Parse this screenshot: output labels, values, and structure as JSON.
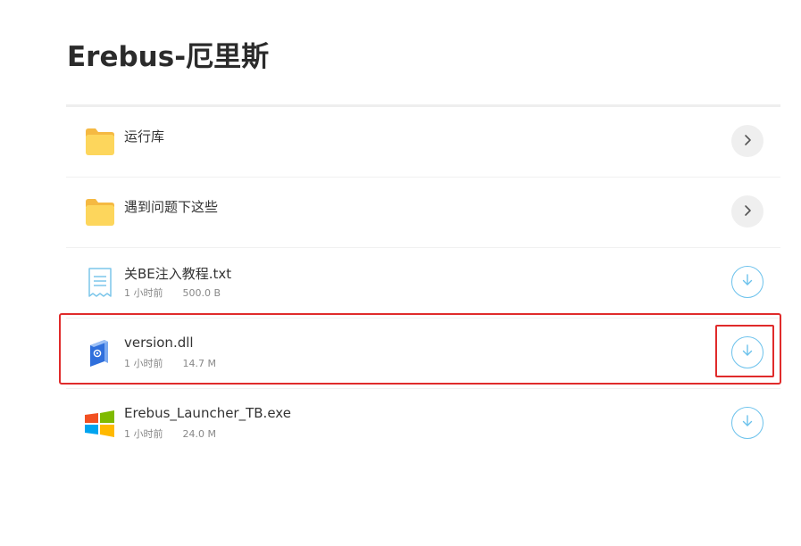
{
  "header": {
    "title": "Erebus-厄里斯"
  },
  "files": [
    {
      "type": "folder",
      "icon": "folder-icon",
      "name": "运行库",
      "action": "chevron-right-icon"
    },
    {
      "type": "folder",
      "icon": "folder-icon",
      "name": "遇到问题下这些",
      "action": "chevron-right-icon"
    },
    {
      "type": "file",
      "icon": "text-file-icon",
      "name": "关BE注入教程.txt",
      "time": "1 小时前",
      "size": "500.0 B",
      "action": "download-icon"
    },
    {
      "type": "file",
      "icon": "dll-file-icon",
      "name": "version.dll",
      "time": "1 小时前",
      "size": "14.7 M",
      "action": "download-icon",
      "highlighted": true
    },
    {
      "type": "file",
      "icon": "windows-exe-icon",
      "name": "Erebus_Launcher_TB.exe",
      "time": "1 小时前",
      "size": "24.0 M",
      "action": "download-icon"
    }
  ],
  "colors": {
    "highlight": "#e02b2b",
    "download_accent": "#6cc2ec",
    "folder": "#fdd65c"
  }
}
